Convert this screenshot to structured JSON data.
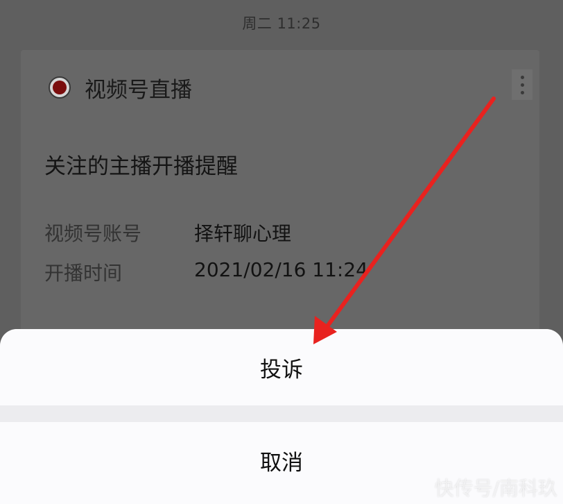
{
  "status_bar": {
    "time": "周二 11:25"
  },
  "card": {
    "header": {
      "title": "视频号直播",
      "icon": "live-record-icon",
      "more_icon": "more-dots-icon"
    },
    "headline": "关注的主播开播提醒",
    "fields": [
      {
        "label": "视频号账号",
        "value": "择轩聊心理"
      },
      {
        "label": "开播时间",
        "value": "2021/02/16 11:24"
      }
    ]
  },
  "action_sheet": {
    "report_label": "投诉",
    "cancel_label": "取消"
  },
  "annotation": {
    "arrow_color": "#e8221f"
  },
  "watermark": {
    "text": "快传号/南科玖"
  },
  "colors": {
    "overlay": "#5f5f5f",
    "sheet": "#fbfbfd",
    "live_dot": "#7b0e0e"
  }
}
